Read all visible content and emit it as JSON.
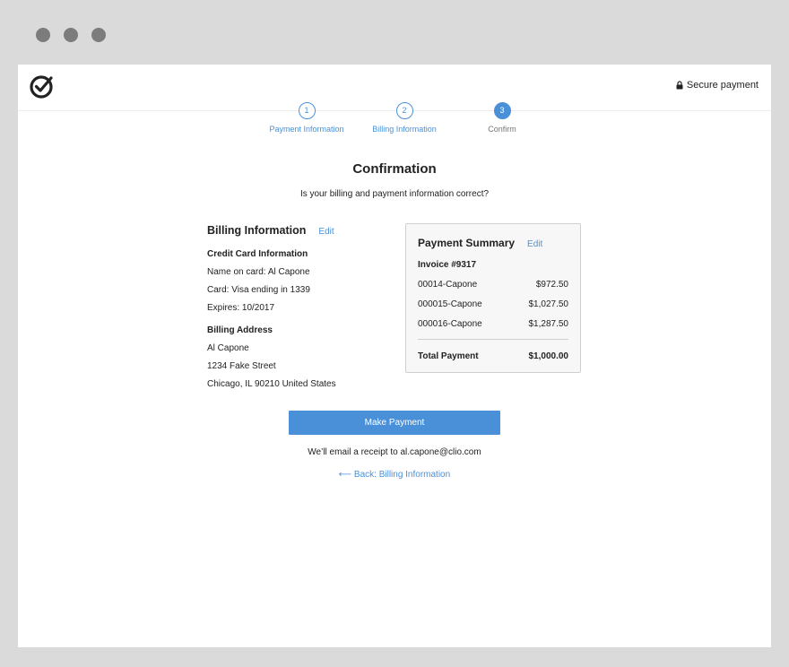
{
  "header": {
    "secure_label": "Secure payment"
  },
  "steps": [
    {
      "number": "1",
      "label": "Payment Information",
      "state": "complete"
    },
    {
      "number": "2",
      "label": "Billing Information",
      "state": "complete"
    },
    {
      "number": "3",
      "label": "Confirm",
      "state": "active"
    }
  ],
  "title": "Confirmation",
  "subtitle": "Is your billing and payment information correct?",
  "billing": {
    "heading": "Billing Information",
    "edit_label": "Edit",
    "card_heading": "Credit Card Information",
    "name_on_card": "Name on card: Al Capone",
    "card": "Card: Visa ending in 1339",
    "expires": "Expires: 10/2017",
    "address_heading": "Billing Address",
    "address_name": "Al Capone",
    "address_street": "1234 Fake Street",
    "address_city": "Chicago, IL 90210 United States"
  },
  "summary": {
    "heading": "Payment Summary",
    "edit_label": "Edit",
    "invoice": "Invoice #9317",
    "items": [
      {
        "name": "00014-Capone",
        "amount": "$972.50"
      },
      {
        "name": "000015-Capone",
        "amount": "$1,027.50"
      },
      {
        "name": "000016-Capone",
        "amount": "$1,287.50"
      }
    ],
    "total_label": "Total Payment",
    "total_amount": "$1,000.00"
  },
  "actions": {
    "pay_label": "Make Payment",
    "receipt_text": "We’ll email a receipt to al.capone@clio.com",
    "back_label": "⟵ Back: Billing Information"
  },
  "colors": {
    "accent": "#4a90d9",
    "frame": "#dadada",
    "window_dots": "#7c7c7c"
  },
  "icons": {
    "logo": "checkmark-circle-icon",
    "lock": "lock-icon"
  }
}
